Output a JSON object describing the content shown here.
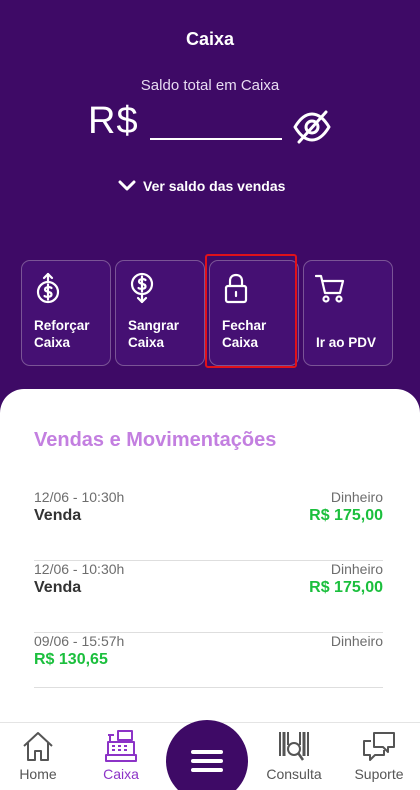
{
  "app": {
    "title": "Caixa"
  },
  "balance": {
    "label": "Saldo total em Caixa",
    "currency": "R$",
    "masked": true,
    "toggle_icon": "eye-off-icon"
  },
  "sales_toggle": {
    "label": "Ver saldo das vendas",
    "icon": "chevron-down-icon"
  },
  "actions": [
    {
      "label": "Reforçar\nCaixa",
      "icon": "money-up-icon"
    },
    {
      "label": "Sangrar\nCaixa",
      "icon": "money-down-icon"
    },
    {
      "label": "Fechar\nCaixa",
      "icon": "lock-icon"
    },
    {
      "label": "Ir ao PDV",
      "icon": "cart-icon"
    }
  ],
  "movements": {
    "title": "Vendas e Movimentações",
    "items": [
      {
        "date": "12/06 - 10:30h",
        "kind": "Venda",
        "method": "Dinheiro",
        "amount": "R$ 175,00"
      },
      {
        "date": "12/06 - 10:30h",
        "kind": "Venda",
        "method": "Dinheiro",
        "amount": "R$ 175,00"
      },
      {
        "date": "09/06 - 15:57h",
        "kind": "",
        "method": "Dinheiro",
        "amount": "R$ 130,65"
      }
    ]
  },
  "nav": {
    "items": [
      {
        "label": "Home",
        "icon": "home-icon"
      },
      {
        "label": "Caixa",
        "icon": "cash-register-icon",
        "active": true
      },
      {
        "label": "Consulta",
        "icon": "barcode-search-icon"
      },
      {
        "label": "Suporte",
        "icon": "chat-bubbles-icon"
      }
    ],
    "menu_icon": "hamburger-icon"
  },
  "colors": {
    "header_bg": "#3e0a66",
    "accent_purple": "#c37fe0",
    "amount_green": "#1bbf3d",
    "highlight_red": "#e0111b"
  }
}
